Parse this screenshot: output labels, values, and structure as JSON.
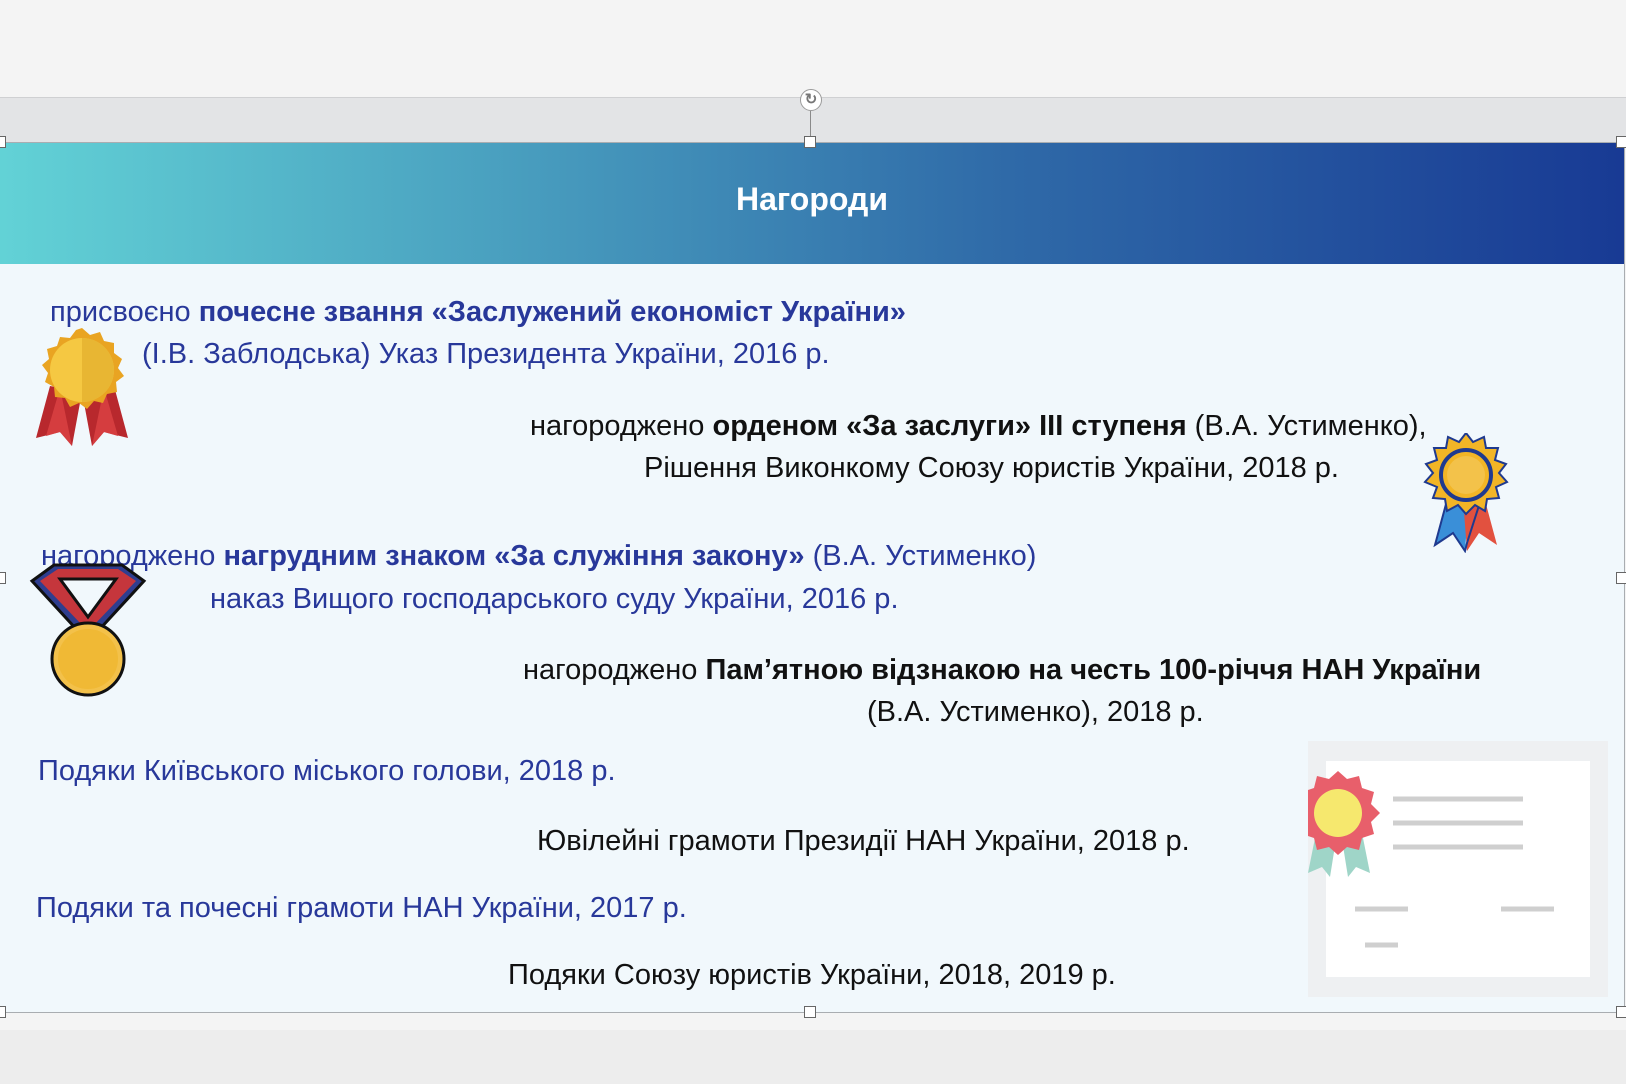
{
  "slide": {
    "title": "Нагороди"
  },
  "awards": {
    "a1_pre": "присвоєно ",
    "a1_bold": "почесне звання «Заслужений економіст України»",
    "a1_line2": "(І.В. Заблодська) Указ Президента України, 2016 р.",
    "a2_pre": "нагороджено ",
    "a2_bold": "орденом «За заслуги» ІІІ ступеня",
    "a2_post": " (В.А. Устименко),",
    "a2_line2": "Рішення Виконкому Союзу юристів України, 2018 р.",
    "a3_pre": "нагороджено ",
    "a3_bold": "нагрудним знаком «За служіння закону»",
    "a3_post": " (В.А. Устименко)",
    "a3_line2": "наказ Вищого господарського суду України, 2016 р.",
    "a4_pre": "нагороджено ",
    "a4_bold": "Пам’ятною відзнакою на честь 100-річчя НАН України",
    "a4_line2": "(В.А. Устименко), 2018 р.",
    "a5": "Подяки Київського міського голови, 2018 р.",
    "a6": "Ювілейні грамоти Президії НАН України, 2018 р.",
    "a7": "Подяки та почесні грамоти НАН України, 2017 р.",
    "a8": "Подяки Союзу юристів України, 2018, 2019 р."
  },
  "icons": [
    "rotate-icon",
    "gold-ribbon-medal-icon",
    "blue-ribbon-badge-icon",
    "neck-medal-icon",
    "certificate-icon"
  ],
  "colors": {
    "header_gradient": [
      "#62d2d6",
      "#183a94"
    ],
    "blue_text": "#28389a",
    "black_text": "#111111"
  }
}
